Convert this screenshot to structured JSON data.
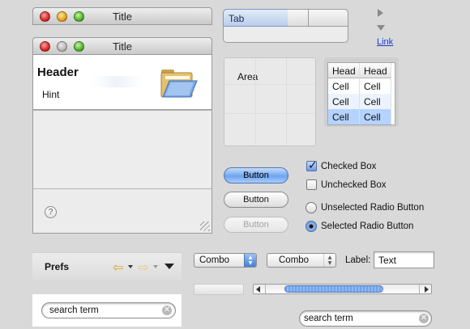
{
  "window_small": {
    "title": "Title"
  },
  "window_main": {
    "title": "Title",
    "header": "Header",
    "hint": "Hint",
    "help_icon": "help-icon",
    "folder_icon": "folder-icon"
  },
  "tabs": {
    "active_label": "Tab"
  },
  "disclosure": {
    "link_text": "Link"
  },
  "area": {
    "label": "Area"
  },
  "table": {
    "headers": [
      "Head",
      "Head"
    ],
    "rows": [
      [
        "Cell",
        "Cell"
      ],
      [
        "Cell",
        "Cell"
      ],
      [
        "Cell",
        "Cell"
      ]
    ],
    "selected_row": 2
  },
  "buttons": {
    "default": "Button",
    "normal": "Button",
    "disabled": "Button"
  },
  "checkboxes": {
    "checked": "Checked Box",
    "unchecked": "Unchecked Box"
  },
  "radios": {
    "unselected": "Unselected Radio Button",
    "selected": "Selected Radio Button"
  },
  "prefs": {
    "label": "Prefs"
  },
  "search_left": {
    "value": "search term"
  },
  "search_right": {
    "value": "search term"
  },
  "combo_1": {
    "value": "Combo"
  },
  "combo_2": {
    "value": "Combo"
  },
  "label_field": {
    "label": "Label:",
    "value": "Text"
  },
  "colors": {
    "accent": "#6ea5ef",
    "background": "#d9d9d9"
  }
}
